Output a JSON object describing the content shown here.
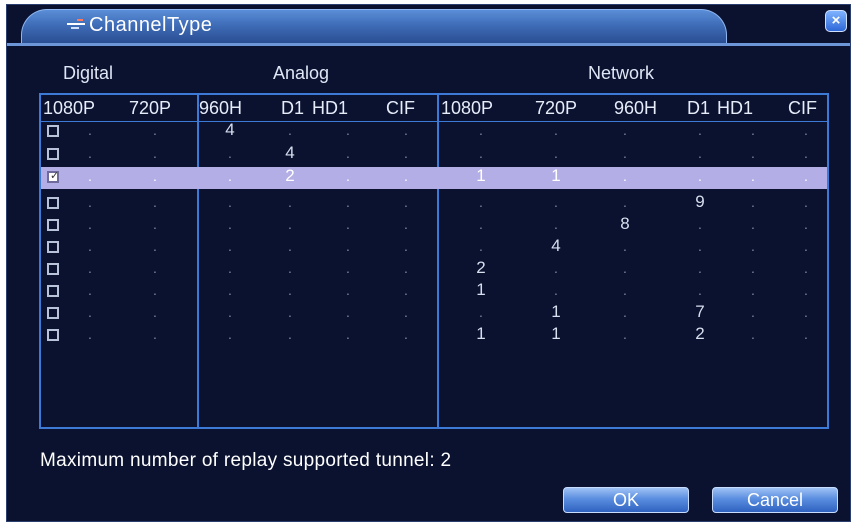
{
  "window": {
    "title": "ChannelType",
    "close_label": "×"
  },
  "groups": {
    "digital": "Digital",
    "analog": "Analog",
    "network": "Network"
  },
  "columns": [
    "1080P",
    "720P",
    "960H",
    "D1",
    "HD1",
    "CIF",
    "1080P",
    "720P",
    "960H",
    "D1",
    "HD1",
    "CIF"
  ],
  "rows": [
    {
      "checked": false,
      "cells": [
        ".",
        ".",
        "4",
        ".",
        ".",
        ".",
        ".",
        ".",
        ".",
        ".",
        ".",
        "."
      ]
    },
    {
      "checked": false,
      "cells": [
        ".",
        ".",
        ".",
        "4",
        ".",
        ".",
        ".",
        ".",
        ".",
        ".",
        ".",
        "."
      ]
    },
    {
      "checked": true,
      "cells": [
        ".",
        ".",
        ".",
        "2",
        ".",
        ".",
        "1",
        "1",
        ".",
        ".",
        ".",
        "."
      ]
    },
    {
      "checked": false,
      "cells": [
        ".",
        ".",
        ".",
        ".",
        ".",
        ".",
        ".",
        ".",
        ".",
        "9",
        ".",
        "."
      ]
    },
    {
      "checked": false,
      "cells": [
        ".",
        ".",
        ".",
        ".",
        ".",
        ".",
        ".",
        ".",
        "8",
        ".",
        ".",
        "."
      ]
    },
    {
      "checked": false,
      "cells": [
        ".",
        ".",
        ".",
        ".",
        ".",
        ".",
        ".",
        "4",
        ".",
        ".",
        ".",
        "."
      ]
    },
    {
      "checked": false,
      "cells": [
        ".",
        ".",
        ".",
        ".",
        ".",
        ".",
        "2",
        ".",
        ".",
        ".",
        ".",
        "."
      ]
    },
    {
      "checked": false,
      "cells": [
        ".",
        ".",
        ".",
        ".",
        ".",
        ".",
        "1",
        ".",
        ".",
        ".",
        ".",
        "."
      ]
    },
    {
      "checked": false,
      "cells": [
        ".",
        ".",
        ".",
        ".",
        ".",
        ".",
        ".",
        "1",
        ".",
        "7",
        ".",
        "."
      ]
    },
    {
      "checked": false,
      "cells": [
        ".",
        ".",
        ".",
        ".",
        ".",
        ".",
        "1",
        "1",
        ".",
        "2",
        ".",
        "."
      ]
    }
  ],
  "footer": {
    "text": "Maximum number of replay supported tunnel: 2"
  },
  "buttons": {
    "ok": "OK",
    "cancel": "Cancel"
  },
  "colors": {
    "background": "#0a1230",
    "border": "#3d7ad8",
    "selected_row": "#b4aee6"
  }
}
